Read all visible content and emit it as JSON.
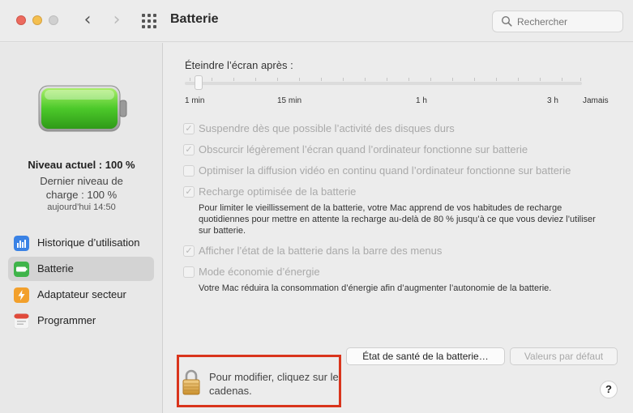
{
  "window": {
    "title": "Batterie"
  },
  "search": {
    "placeholder": "Rechercher"
  },
  "sidebar": {
    "level_title": "Niveau actuel : 100 %",
    "last_level": "Dernier niveau de charge : 100 %",
    "last_time": "aujourd’hui 14:50",
    "items": [
      {
        "label": "Historique d’utilisation",
        "icon": "usage-history-icon",
        "color": "#3a82e5"
      },
      {
        "label": "Batterie",
        "icon": "battery-icon",
        "color": "#3fb44a",
        "selected": true
      },
      {
        "label": "Adaptateur secteur",
        "icon": "power-adapter-icon",
        "color": "#f2a02c"
      },
      {
        "label": "Programmer",
        "icon": "calendar-icon",
        "color": "#e04a3a"
      }
    ]
  },
  "main": {
    "sleep_label": "Éteindre l’écran après :",
    "slider": {
      "labels": [
        "1 min",
        "15 min",
        "1 h",
        "3 h",
        "Jamais"
      ],
      "value": "1 min"
    },
    "options": [
      {
        "label": "Suspendre dès que possible l’activité des disques durs",
        "checked": true
      },
      {
        "label": "Obscurcir légèrement l’écran quand l’ordinateur fonctionne sur batterie",
        "checked": true
      },
      {
        "label": "Optimiser la diffusion vidéo en continu quand l’ordinateur fonctionne sur batterie",
        "checked": false
      },
      {
        "label": "Recharge optimisée de la batterie",
        "checked": true,
        "description": "Pour limiter le vieillissement de la batterie, votre Mac apprend de vos habitudes de recharge quotidiennes pour mettre en attente la recharge au-delà de 80 % jusqu’à ce que vous deviez l’utiliser sur batterie."
      },
      {
        "label": "Afficher l’état de la batterie dans la barre des menus",
        "checked": true
      },
      {
        "label": "Mode économie d’énergie",
        "checked": false,
        "description": "Votre Mac réduira la consommation d’énergie afin d’augmenter l’autonomie de la batterie."
      }
    ],
    "health_button": "État de santé de la batterie…",
    "defaults_button": "Valeurs par défaut",
    "lock_text": "Pour modifier, cliquez sur le cadenas.",
    "help": "?"
  },
  "colors": {
    "highlight": "#d9341c",
    "battery_fill": "#4cc92a"
  }
}
